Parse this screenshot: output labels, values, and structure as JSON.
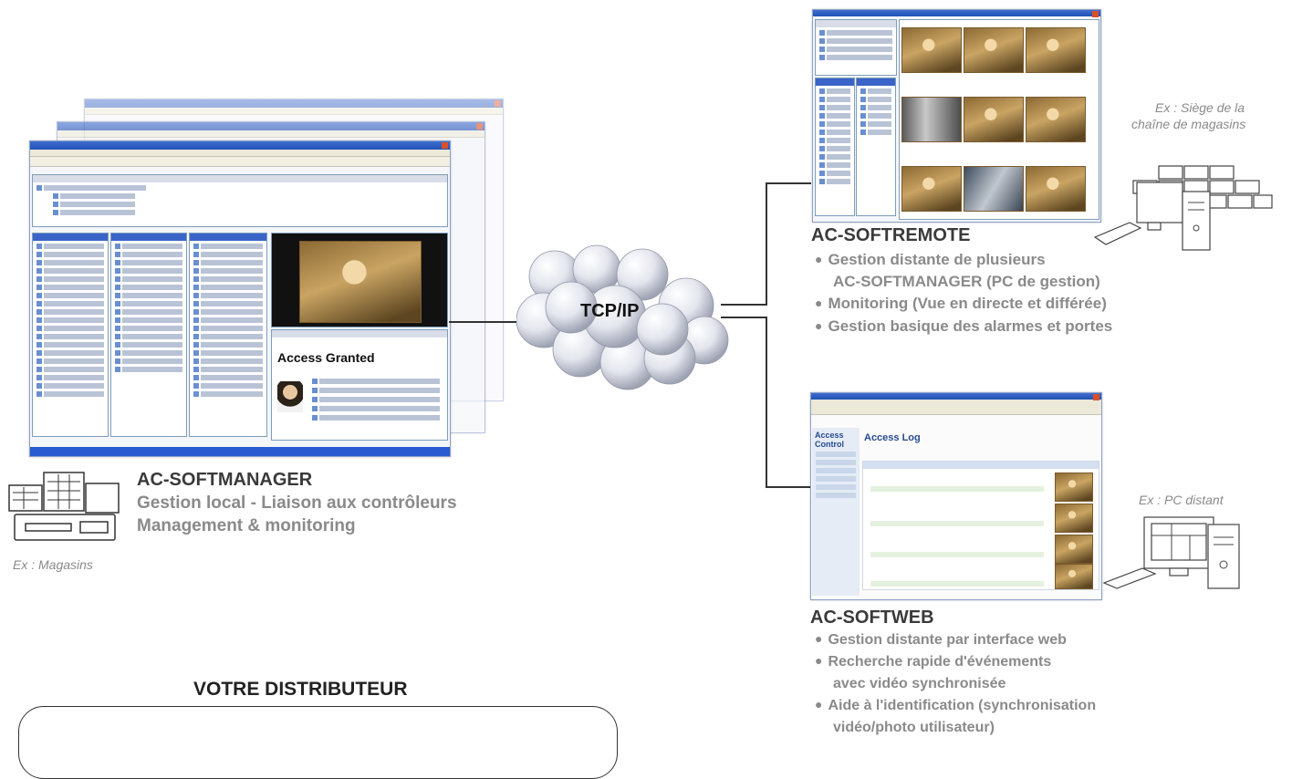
{
  "center": {
    "label": "TCP/IP"
  },
  "manager": {
    "title": "AC-SOFTMANAGER",
    "lines": [
      "Gestion local - Liaison aux contrôleurs",
      "Management & monitoring"
    ],
    "example": "Ex : Magasins",
    "screen": {
      "popup_title": "Access Granted"
    }
  },
  "remote": {
    "title": "AC-SOFTREMOTE",
    "bullets": [
      "Gestion distante de plusieurs",
      "Monitoring (Vue en directe et différée)",
      "Gestion basique des alarmes et portes"
    ],
    "bullet1_cont": "AC-SOFTMANAGER (PC de gestion)",
    "example_line1": "Ex : Siège de la",
    "example_line2": "chaîne de magasins"
  },
  "web": {
    "title": "AC-SOFTWEB",
    "bullets": [
      "Gestion distante par interface web",
      "Recherche rapide d'événements",
      "Aide à l'identification (synchronisation"
    ],
    "bullet2_cont": "avec vidéo synchronisée",
    "bullet3_cont": "vidéo/photo utilisateur)",
    "example": "Ex : PC distant",
    "screen": {
      "sidebar_title": "Access Control",
      "main_title": "Access Log"
    }
  },
  "distributor": {
    "title": "VOTRE DISTRIBUTEUR"
  }
}
